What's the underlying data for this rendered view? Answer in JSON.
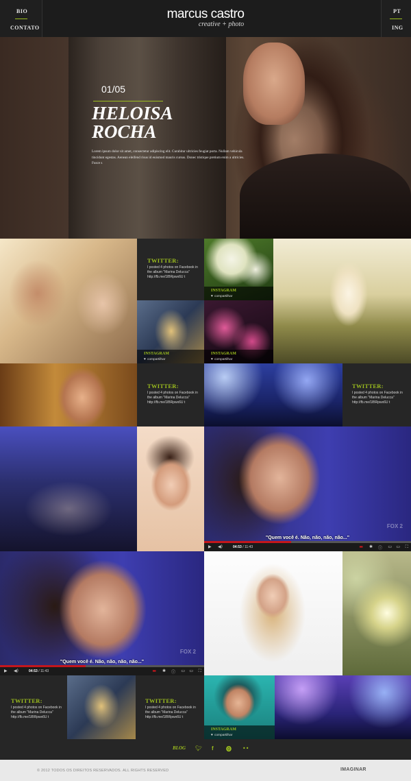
{
  "header": {
    "nav_left": [
      "BIO",
      "CONTATO"
    ],
    "nav_right": [
      "PT",
      "ING"
    ],
    "logo": "marcus castro",
    "tagline": "creative + photo"
  },
  "hero": {
    "counter": "01/05",
    "title_line1": "HELOISA",
    "title_line2": "ROCHA",
    "text": "Lorem ipsum dolor sit amet, consectetur adipiscing elit. Curabitur ultricies feugiat porta. Nullam vehicula tincidunt egestas. Aenean eleifend risus id euismod mauris cursus. Donec tristique pretium enim a ultricies. Fusce s"
  },
  "twitter": {
    "title": "TWITTER:",
    "body": "I posted 4 photos on Facebook in the album \"Marina Delucca\" http://fb.me/1lBRpwx6U t"
  },
  "instagram": {
    "title": "INSTAGRAM",
    "share": "compartilhar"
  },
  "video": {
    "caption": "\"Quem você é. Não, não, não, não...\"",
    "time_current": "04:53",
    "time_total": "/ 11:43",
    "progress": 0.42,
    "watermark": "FOX 2"
  },
  "social": {
    "blog": "BLOG",
    "icons": [
      "twitter-icon",
      "facebook-icon",
      "pinterest-icon",
      "flickr-icon"
    ]
  },
  "footer": {
    "copyright": "© 2012 TODOS OS DIREITOS RESERVADOS. ALL RIGHTS RESERVED",
    "brand": "IMAGINAR"
  },
  "colors": {
    "accent": "#9dbf1e",
    "background": "#262626",
    "video_progress": "#c4161c"
  }
}
